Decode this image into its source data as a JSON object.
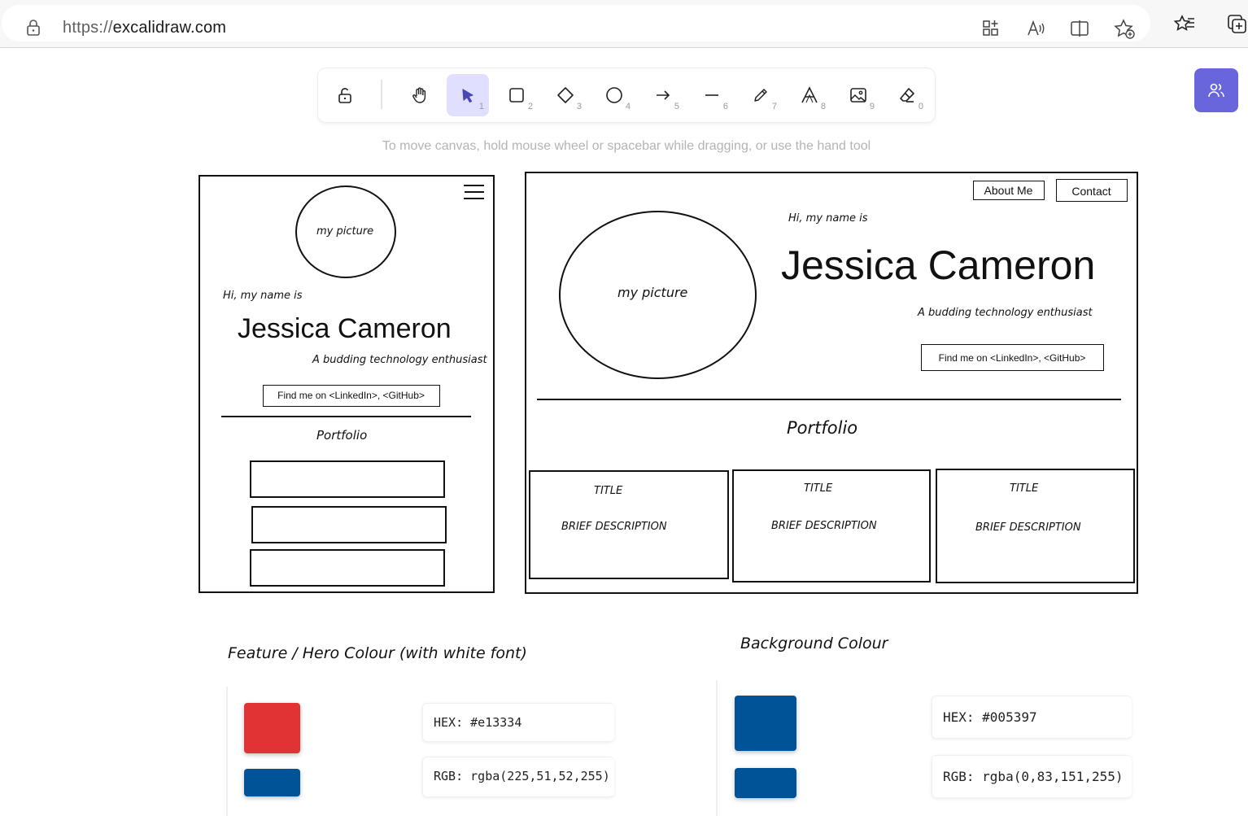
{
  "browser": {
    "url_protocol": "https://",
    "url_host": "excalidraw.com"
  },
  "toolbar": {
    "tools": [
      {
        "name": "lock",
        "key": ""
      },
      {
        "name": "hand",
        "key": ""
      },
      {
        "name": "selection",
        "key": "1"
      },
      {
        "name": "rectangle",
        "key": "2"
      },
      {
        "name": "diamond",
        "key": "3"
      },
      {
        "name": "ellipse",
        "key": "4"
      },
      {
        "name": "arrow",
        "key": "5"
      },
      {
        "name": "line",
        "key": "6"
      },
      {
        "name": "draw",
        "key": "7"
      },
      {
        "name": "text",
        "key": "8"
      },
      {
        "name": "image",
        "key": "9"
      },
      {
        "name": "eraser",
        "key": "0"
      }
    ],
    "active_tool": "selection",
    "accent": "#6965db"
  },
  "hint": "To move canvas, hold mouse wheel or spacebar while dragging, or use the hand tool",
  "mobile": {
    "picture": "my picture",
    "greeting": "Hi, my name is",
    "name": "Jessica Cameron",
    "tagline": "A budding technology enthusiast",
    "links": "Find me on <LinkedIn>, <GitHub>",
    "portfolio": "Portfolio"
  },
  "desktop": {
    "nav_about": "About Me",
    "nav_contact": "Contact",
    "picture": "my picture",
    "greeting": "Hi, my name is",
    "name": "Jessica Cameron",
    "tagline": "A budding technology enthusiast",
    "links": "Find me on <LinkedIn>, <GitHub>",
    "portfolio": "Portfolio",
    "cards": [
      {
        "title": "TITLE",
        "desc": "BRIEF DESCRIPTION"
      },
      {
        "title": "TITLE",
        "desc": "BRIEF DESCRIPTION"
      },
      {
        "title": "TITLE",
        "desc": "BRIEF DESCRIPTION"
      }
    ]
  },
  "colours": {
    "hero_heading": "Feature / Hero Colour (with white font)",
    "hero_hex": "HEX: #e13334",
    "hero_rgb": "RGB: rgba(225,51,52,255)",
    "hero_color": "#e13334",
    "bg_heading": "Background Colour",
    "bg_hex": "HEX: #005397",
    "bg_rgb": "RGB: rgba(0,83,151,255)",
    "bg_color": "#005397"
  }
}
